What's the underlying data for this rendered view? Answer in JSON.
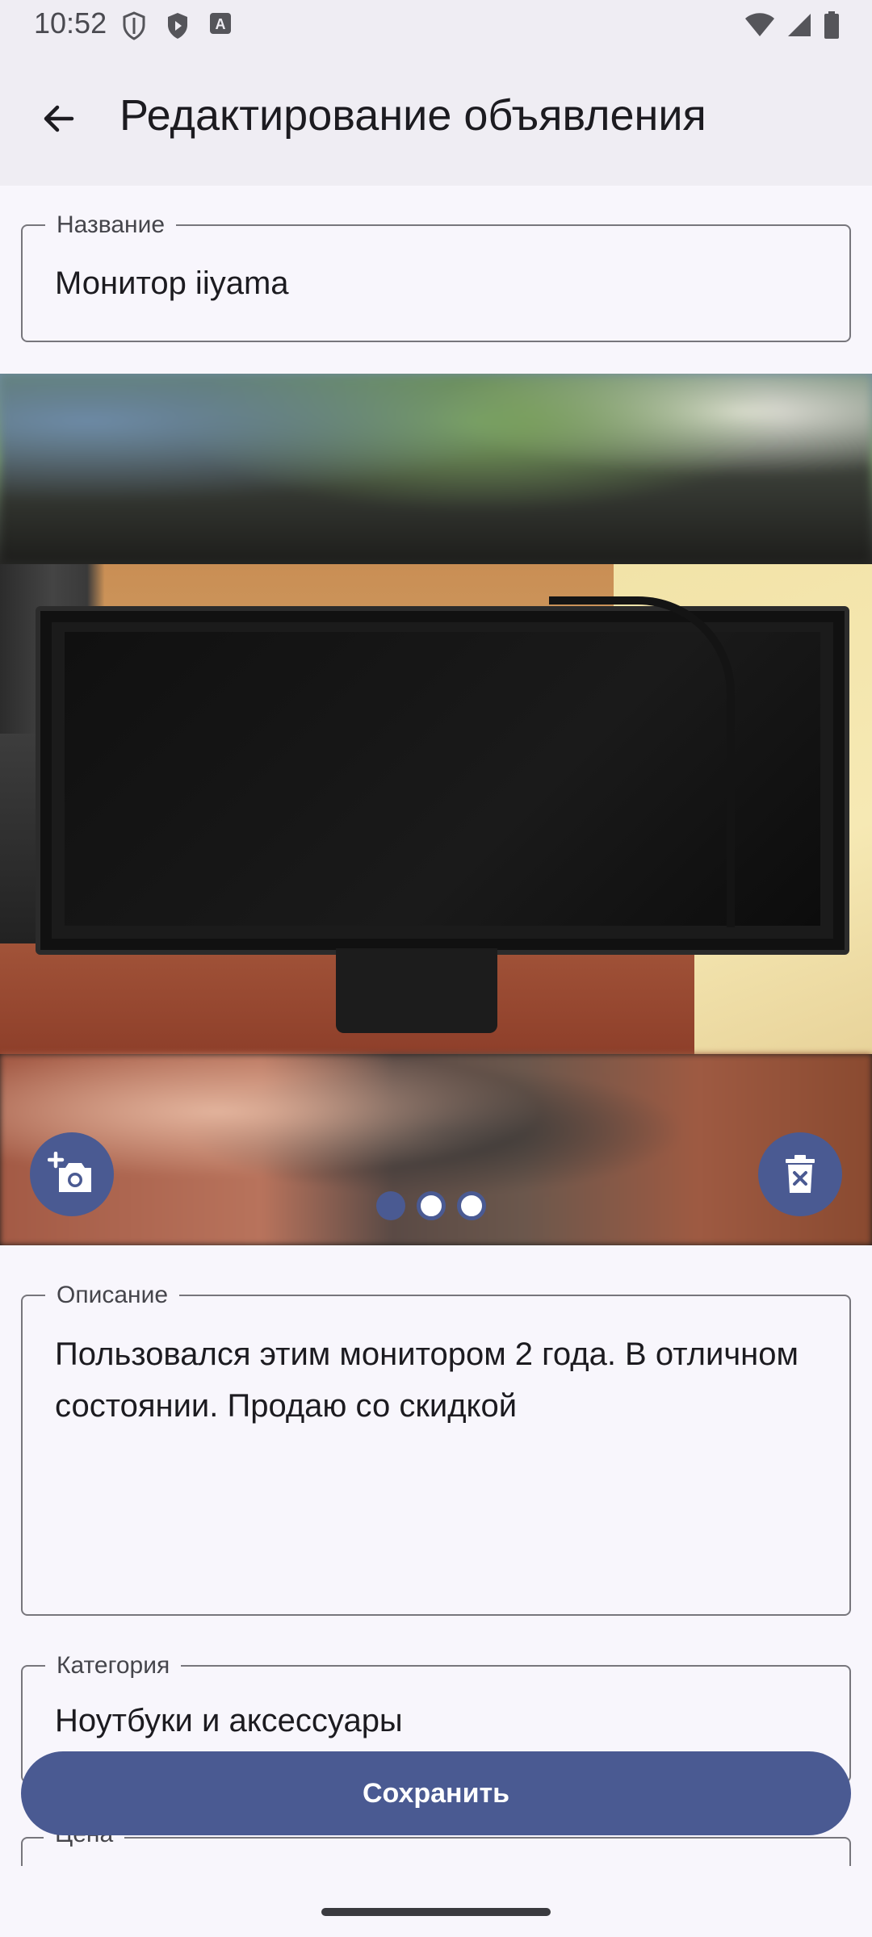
{
  "status_bar": {
    "time": "10:52",
    "left_icons": [
      "shield-icon",
      "play-protect-icon",
      "accessibility-icon"
    ],
    "right_icons": [
      "wifi-icon",
      "signal-icon",
      "battery-icon"
    ]
  },
  "app_bar": {
    "back_icon": "arrow-back-icon",
    "title": "Редактирование объявления"
  },
  "form": {
    "name": {
      "label": "Название",
      "value": "Монитор iiyama"
    },
    "photos": {
      "count": 3,
      "active_index": 0,
      "add_photo_icon": "add-photo-icon",
      "delete_photo_icon": "delete-icon"
    },
    "description": {
      "label": "Описание",
      "value": "Пользовался этим монитором 2 года. В отличном состоянии. Продаю со скидкой"
    },
    "category": {
      "label": "Категория",
      "value": "Ноутбуки и аксессуары"
    },
    "price": {
      "label": "Цена"
    }
  },
  "actions": {
    "save_label": "Сохранить"
  },
  "colors": {
    "primary": "#4a5a92",
    "background": "#f8f6fc",
    "app_bar": "#efedf3",
    "outline": "#77767c"
  }
}
